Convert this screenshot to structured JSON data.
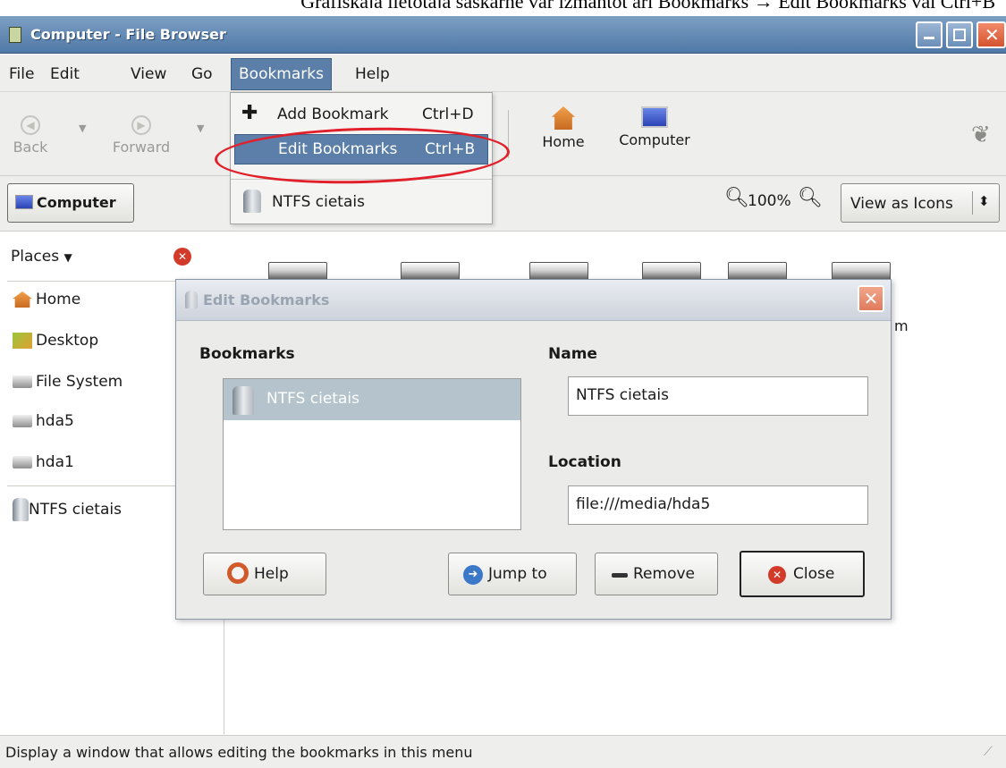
{
  "caption": "Grafiskajā lietotāja saskarnē var izmantot arī Bookmarks → Edit Bookmarks vai Ctrl+B",
  "window": {
    "title": "Computer - File Browser"
  },
  "menubar": [
    {
      "label": "File"
    },
    {
      "label": "Edit"
    },
    {
      "label": "View"
    },
    {
      "label": "Go"
    },
    {
      "label": "Bookmarks"
    },
    {
      "label": "Help"
    }
  ],
  "toolbar": {
    "back": "Back",
    "forward": "Forward",
    "home": "Home",
    "computer": "Computer"
  },
  "location": {
    "button": "Computer",
    "zoom": "100%",
    "view_mode": "View as Icons"
  },
  "bookmarks_menu": {
    "add": "Add Bookmark",
    "add_shortcut": "Ctrl+D",
    "edit": "Edit Bookmarks",
    "edit_shortcut": "Ctrl+B",
    "entry": "NTFS cietais"
  },
  "sidebar": {
    "header": "Places",
    "items": [
      {
        "label": "Home"
      },
      {
        "label": "Desktop"
      },
      {
        "label": "File System"
      },
      {
        "label": "hda5"
      },
      {
        "label": "hda1"
      },
      {
        "label": "NTFS cietais"
      }
    ]
  },
  "content": {
    "partial_label": "m"
  },
  "dialog": {
    "title": "Edit Bookmarks",
    "bookmarks_label": "Bookmarks",
    "list": [
      {
        "label": "NTFS cietais"
      }
    ],
    "name_label": "Name",
    "name_value": "NTFS cietais",
    "location_label": "Location",
    "location_value": "file:///media/hda5",
    "buttons": {
      "help": "Help",
      "jump": "Jump to",
      "remove": "Remove",
      "close": "Close"
    }
  },
  "status": "Display a window that allows editing the bookmarks in this menu",
  "colors": {
    "selection": "#5b7fa8",
    "highlight": "#e0202a"
  }
}
